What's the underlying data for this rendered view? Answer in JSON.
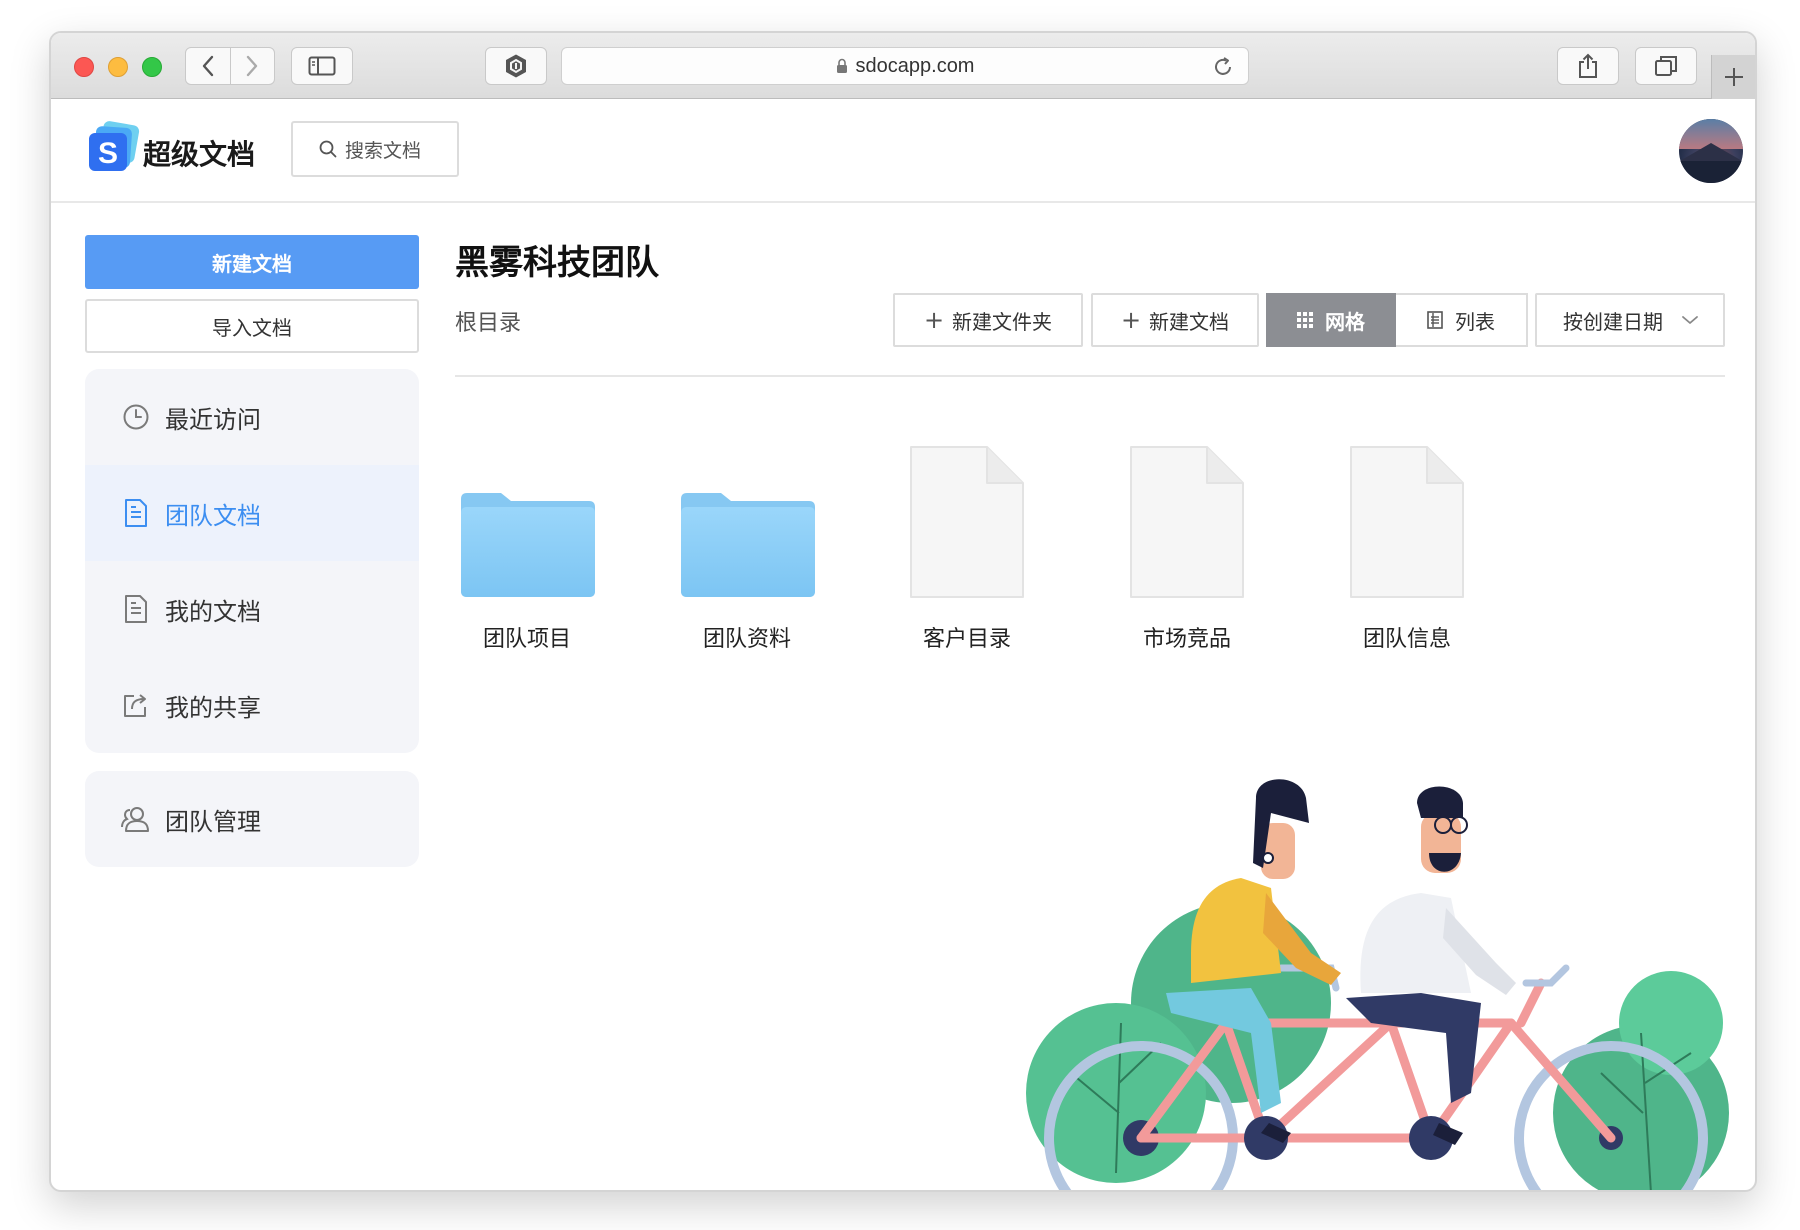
{
  "browser": {
    "url": "sdocapp.com"
  },
  "app": {
    "brand": "超级文档",
    "logo_letter": "S",
    "search_placeholder": "搜索文档"
  },
  "sidebar": {
    "new_doc": "新建文档",
    "import_doc": "导入文档",
    "items": [
      {
        "label": "最近访问",
        "icon": "clock-icon",
        "active": false
      },
      {
        "label": "团队文档",
        "icon": "document-icon",
        "active": true
      },
      {
        "label": "我的文档",
        "icon": "document-icon",
        "active": false
      },
      {
        "label": "我的共享",
        "icon": "share-icon",
        "active": false
      }
    ],
    "team_manage": {
      "label": "团队管理",
      "icon": "team-icon"
    }
  },
  "main": {
    "team_title": "黑雾科技团队",
    "breadcrumb": "根目录",
    "toolbar": {
      "new_folder": "新建文件夹",
      "new_doc": "新建文档",
      "grid": "网格",
      "list": "列表",
      "sort": "按创建日期"
    },
    "files": [
      {
        "name": "团队项目",
        "type": "folder"
      },
      {
        "name": "团队资料",
        "type": "folder"
      },
      {
        "name": "客户目录",
        "type": "document"
      },
      {
        "name": "市场竞品",
        "type": "document"
      },
      {
        "name": "团队信息",
        "type": "document"
      }
    ]
  },
  "colors": {
    "primary": "#579bf4",
    "active_text": "#3c8ef1",
    "folder": "#8fd0f7",
    "grid_selected": "#8c8e93"
  }
}
